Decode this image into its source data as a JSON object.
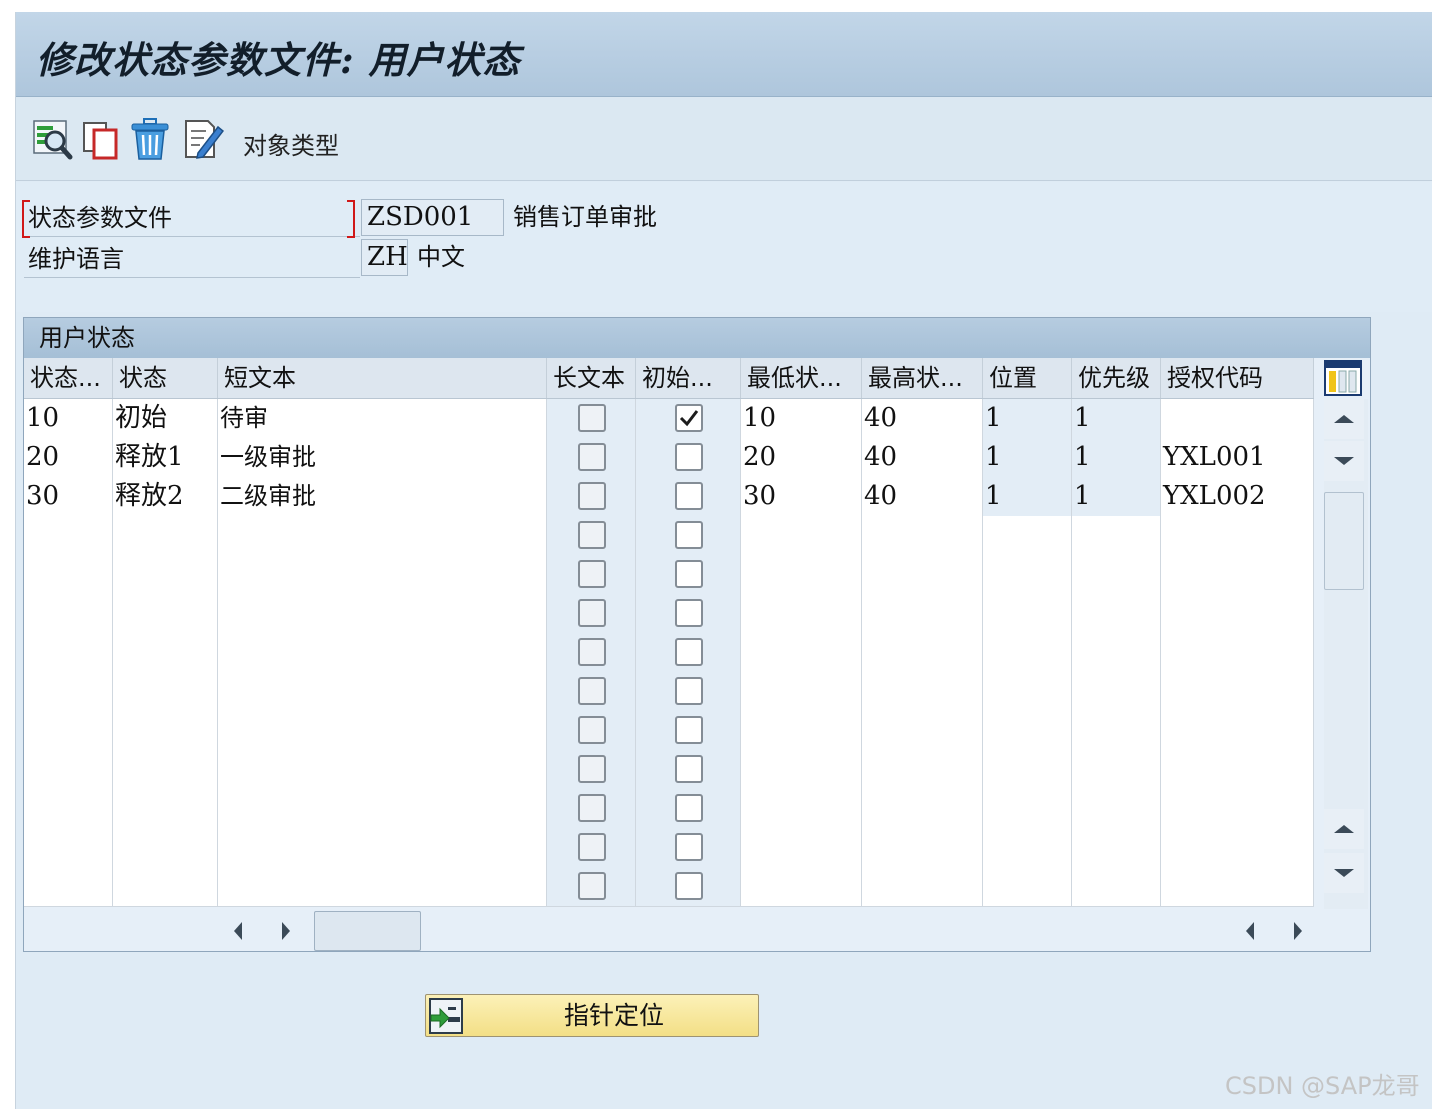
{
  "window": {
    "title": "修改状态参数文件: 用户状态"
  },
  "toolbar": {
    "buttons": [
      {
        "icon": "find-icon"
      },
      {
        "icon": "copy-icon"
      },
      {
        "icon": "delete-icon"
      },
      {
        "icon": "edit-icon"
      }
    ],
    "object_type_label": "对象类型"
  },
  "form": {
    "status_profile": {
      "label": "状态参数文件",
      "value": "ZSD001",
      "description": "销售订单审批"
    },
    "language": {
      "label": "维护语言",
      "value": "ZH",
      "description": "中文"
    }
  },
  "table": {
    "title": "用户状态",
    "columns": [
      "状态...",
      "状态",
      "短文本",
      "长文本",
      "初始...",
      "最低状...",
      "最高状...",
      "位置",
      "优先级",
      "授权代码"
    ],
    "rows": [
      {
        "no": "10",
        "status": "初始",
        "text": "待审",
        "long_text": false,
        "initial": true,
        "min": "10",
        "max": "40",
        "pos": "1",
        "prio": "1",
        "auth": ""
      },
      {
        "no": "20",
        "status": "释放1",
        "text": "一级审批",
        "long_text": false,
        "initial": false,
        "min": "20",
        "max": "40",
        "pos": "1",
        "prio": "1",
        "auth": "YXL001"
      },
      {
        "no": "30",
        "status": "释放2",
        "text": "二级审批",
        "long_text": false,
        "initial": false,
        "min": "30",
        "max": "40",
        "pos": "1",
        "prio": "1",
        "auth": "YXL002"
      }
    ],
    "empty_rows": 10
  },
  "position_button": {
    "label": "指针定位",
    "icon": "position-cursor-icon"
  },
  "watermark": "CSDN @SAP龙哥",
  "colors": {
    "title_bar": "#aec6dc",
    "background": "#dfebf5",
    "button": "#f3df86"
  }
}
